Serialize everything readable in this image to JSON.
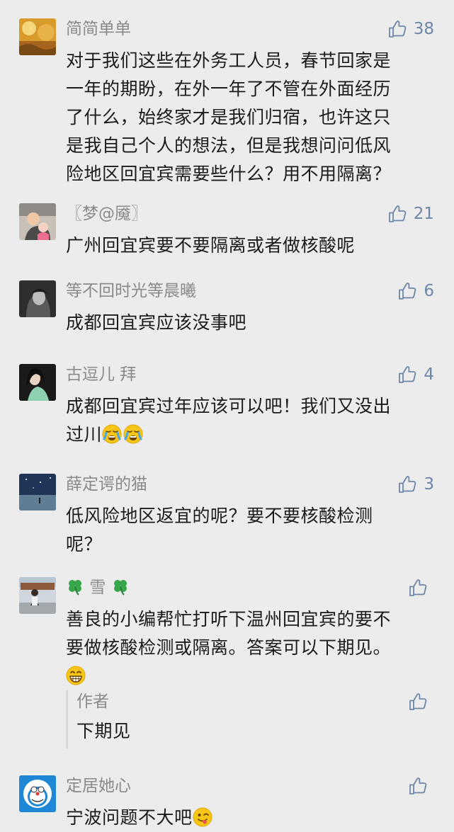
{
  "comments": [
    {
      "username": "简简单单",
      "likes": "38",
      "lines": [
        "对于我们这些在外务工人员，春节回家是",
        "一年的期盼，在外一年了不管在外面经历",
        "了什么，始终家才是我们归宿，也许这只",
        "是我自己个人的想法，但是我想问问低风",
        "险地区回宜宾需要些什么？用不用隔离？"
      ]
    },
    {
      "username": "〖梦@魇〗",
      "likes": "21",
      "lines": [
        "广州回宜宾要不要隔离或者做核酸呢"
      ]
    },
    {
      "username": "等不回时光等晨曦",
      "likes": "6",
      "lines": [
        "成都回宜宾应该没事吧"
      ]
    },
    {
      "username": "古逗儿 拜",
      "likes": "4",
      "lines": [
        "成都回宜宾过年应该可以吧！我们又没出",
        "过川"
      ]
    },
    {
      "username": "薛定谔的猫",
      "likes": "3",
      "lines": [
        "低风险地区返宜的呢？要不要核酸检测",
        "呢？"
      ]
    },
    {
      "username": "雪",
      "likes": "",
      "lines": [
        "善良的小编帮忙打听下温州回宜宾的要不",
        "要做核酸检测或隔离。答案可以下期见。"
      ]
    },
    {
      "username": "定居她心",
      "likes": "",
      "lines": [
        "宁波问题不大吧"
      ]
    }
  ],
  "reply": {
    "username": "作者",
    "likes": "",
    "text": "下期见"
  },
  "colors": {
    "background": "#ececec",
    "username": "#8a8a8a",
    "like": "#6e87a8",
    "text": "#1b1b1b"
  }
}
